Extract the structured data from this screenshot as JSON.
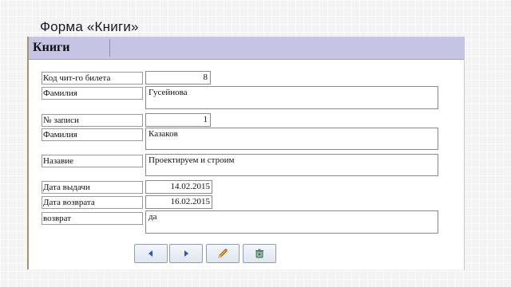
{
  "slide_title": "Форма «Книги»",
  "form": {
    "title": "Книги",
    "fields": [
      {
        "label": "Код чит-го билета",
        "value": "8"
      },
      {
        "label": "Фамилия",
        "value": "Гусейнова"
      },
      {
        "label": "№ записи",
        "value": "1"
      },
      {
        "label": "Фамилия",
        "value": "Казаков"
      },
      {
        "label": "Назавие",
        "value": "Проектируем и строим"
      },
      {
        "label": "Дата выдачи",
        "value": "14.02.2015"
      },
      {
        "label": "Дата возврата",
        "value": "16.02.2015"
      },
      {
        "label": "возврат",
        "value": "да"
      }
    ]
  },
  "buttons": [
    {
      "icon": "arrow-left-icon"
    },
    {
      "icon": "arrow-right-icon"
    },
    {
      "icon": "pencil-icon"
    },
    {
      "icon": "delete-icon"
    }
  ]
}
